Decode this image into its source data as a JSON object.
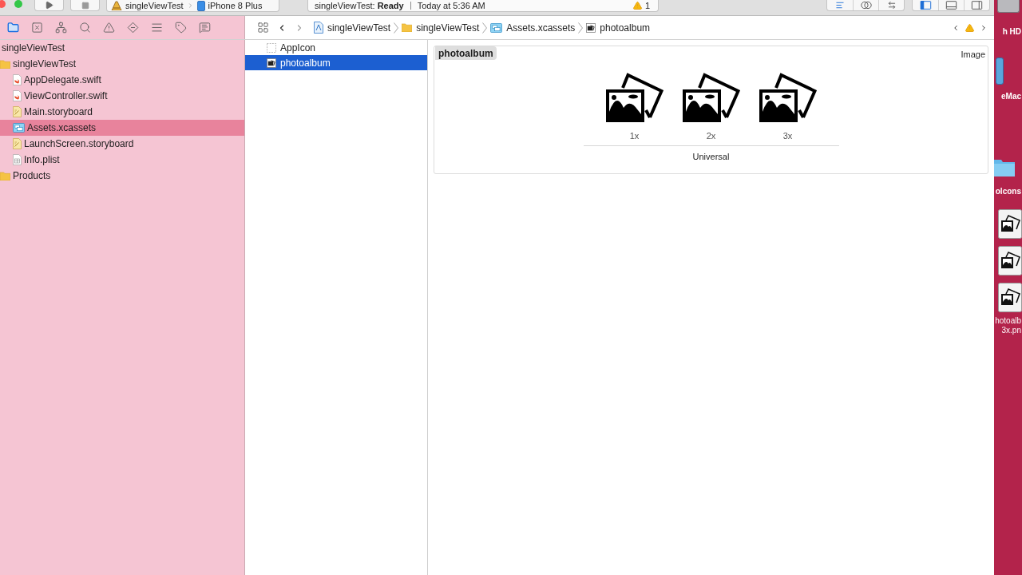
{
  "toolbar": {
    "scheme": {
      "target": "singleViewTest",
      "device": "iPhone 8 Plus"
    },
    "status": {
      "text": "singleViewTest: **Ready**",
      "time": "Today at 5:36 AM",
      "warnings": "1"
    },
    "editor_modes": [
      {
        "selected": true
      },
      {
        "selected": false
      },
      {
        "selected": false
      }
    ],
    "panels": [
      {
        "selected": true
      },
      {
        "selected": false
      },
      {
        "selected": false
      }
    ]
  },
  "navigator_tabs": [
    {
      "selected": true
    },
    {
      "selected": false
    },
    {
      "selected": false
    },
    {
      "selected": false
    },
    {
      "selected": false
    },
    {
      "selected": false
    },
    {
      "selected": false
    },
    {
      "selected": false
    },
    {
      "selected": false
    }
  ],
  "jump_bar": {
    "path": [
      {
        "kind": "project",
        "label": "singleViewTest"
      },
      {
        "kind": "folder",
        "label": "singleViewTest"
      },
      {
        "kind": "assets",
        "label": "Assets.xcassets"
      },
      {
        "kind": "imageset",
        "label": "photoalbum"
      }
    ]
  },
  "project_tree": {
    "name": "singleViewTest",
    "selected": false,
    "children": [
      {
        "name": "singleViewTest",
        "kind": "folder",
        "selected": false,
        "children": [
          {
            "name": "AppDelegate.swift",
            "kind": "swift",
            "selected": false
          },
          {
            "name": "ViewController.swift",
            "kind": "swift",
            "selected": false
          },
          {
            "name": "Main.storyboard",
            "kind": "storyboard",
            "selected": false
          },
          {
            "name": "Assets.xcassets",
            "kind": "assets",
            "selected": true
          },
          {
            "name": "LaunchScreen.storyboard",
            "kind": "storyboard",
            "selected": false
          },
          {
            "name": "Info.plist",
            "kind": "plist",
            "selected": false
          }
        ]
      },
      {
        "name": "Products",
        "kind": "folder",
        "selected": false
      }
    ]
  },
  "asset_list": [
    {
      "name": "AppIcon",
      "kind": "appicon",
      "selected": false
    },
    {
      "name": "photoalbum",
      "kind": "imageset",
      "selected": true
    }
  ],
  "asset_detail": {
    "name": "photoalbum",
    "type": "Image",
    "slots": [
      {
        "label": "1x"
      },
      {
        "label": "2x"
      },
      {
        "label": "3x"
      }
    ],
    "device": "Universal"
  },
  "desktop": [
    {
      "kind": "disk",
      "label": "h HD"
    },
    {
      "kind": "computer",
      "label": "eMac"
    },
    {
      "kind": "folder",
      "label": "olcons"
    },
    {
      "kind": "image"
    },
    {
      "kind": "image"
    },
    {
      "kind": "image",
      "lines": [
        "hotoalb",
        "3x.pn"
      ]
    }
  ]
}
